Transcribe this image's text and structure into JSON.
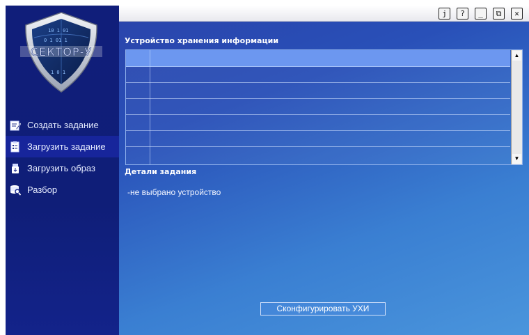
{
  "app": {
    "logo_text": "СЕКТОР-У"
  },
  "toolbar": {
    "buttons": [
      {
        "name": "info-button",
        "glyph": "j"
      },
      {
        "name": "help-button",
        "glyph": "?"
      },
      {
        "name": "minimize-button",
        "glyph": "_"
      },
      {
        "name": "restore-button",
        "glyph": "⧉"
      },
      {
        "name": "close-button",
        "glyph": "✕"
      }
    ]
  },
  "sidebar": {
    "items": [
      {
        "label": "Создать задание",
        "icon": "create-task-icon",
        "active": false
      },
      {
        "label": "Загрузить задание",
        "icon": "load-task-icon",
        "active": true
      },
      {
        "label": "Загрузить образ",
        "icon": "load-image-icon",
        "active": false
      },
      {
        "label": "Разбор",
        "icon": "analysis-icon",
        "active": false
      }
    ]
  },
  "main": {
    "storage_title": "Устройство хранения информации",
    "details_title": "Детали задания",
    "details_text": "-не выбрано устройство",
    "configure_button": "Сконфигурировать УХИ"
  },
  "colors": {
    "sidebar_bg": "#101e7a",
    "selected_row": "#6c97f0",
    "active_menu": "#17259b"
  }
}
